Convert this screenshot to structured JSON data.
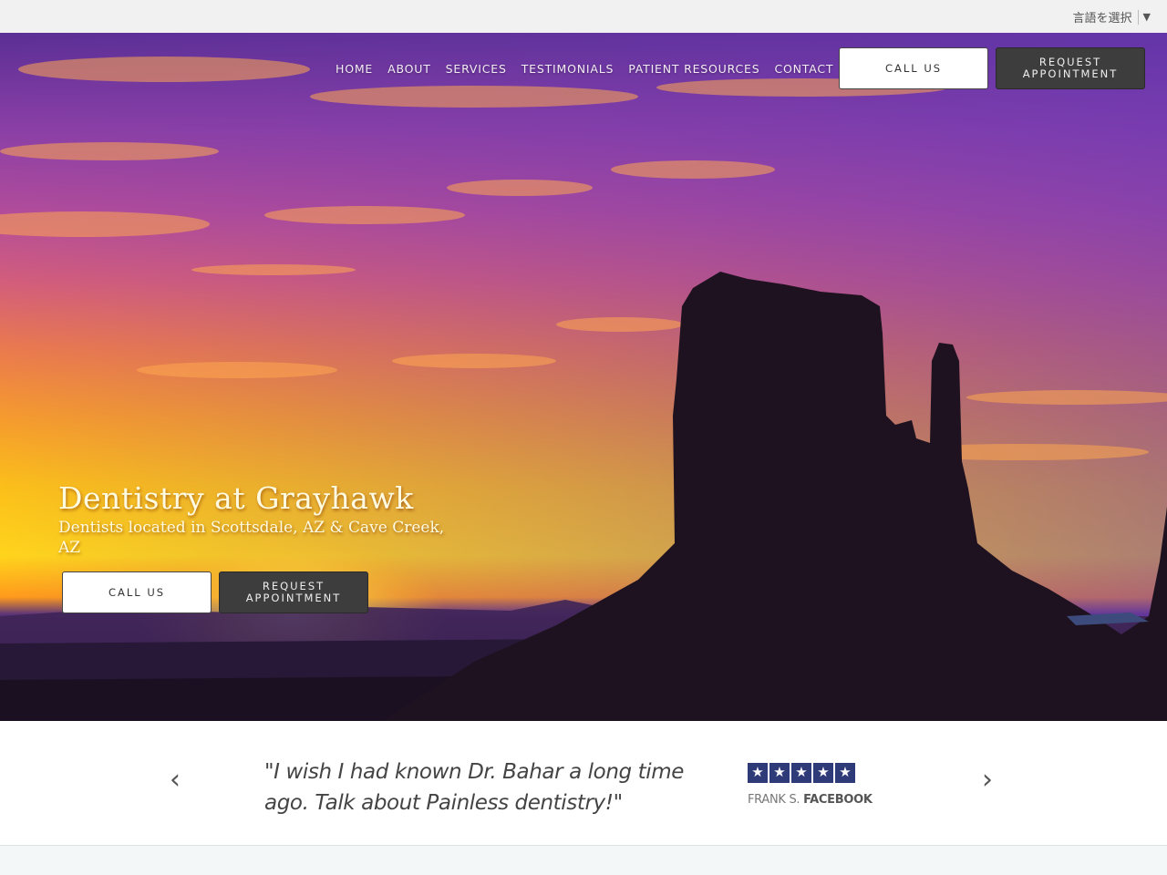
{
  "language_selector": {
    "label": "言語を選択",
    "arrow": "▼"
  },
  "nav": {
    "items": [
      {
        "label": "HOME"
      },
      {
        "label": "ABOUT"
      },
      {
        "label": "SERVICES"
      },
      {
        "label": "TESTIMONIALS"
      },
      {
        "label": "PATIENT RESOURCES"
      },
      {
        "label": "CONTACT"
      }
    ],
    "call_label": "CALL US",
    "request_label_line1": "REQUEST",
    "request_label_line2": "APPOINTMENT"
  },
  "hero": {
    "title": "Dentistry at Grayhawk",
    "subtitle": "Dentists located in Scottsdale, AZ & Cave Creek, AZ",
    "call_label": "CALL US",
    "request_label_line1": "REQUEST",
    "request_label_line2": "APPOINTMENT"
  },
  "testimonial": {
    "quote": "\"I wish I had known Dr. Bahar a long time ago. Talk about Painless dentistry!\"",
    "rating": 5,
    "rating_max": 5,
    "star_glyph": "★",
    "author": "FRANK S.",
    "source": "FACEBOOK",
    "prev_icon": "‹",
    "next_icon": "›"
  },
  "colors": {
    "star_bg": "#2f3a78",
    "dark_button": "#3d3d3d",
    "topbar": "#f1f1f1"
  }
}
